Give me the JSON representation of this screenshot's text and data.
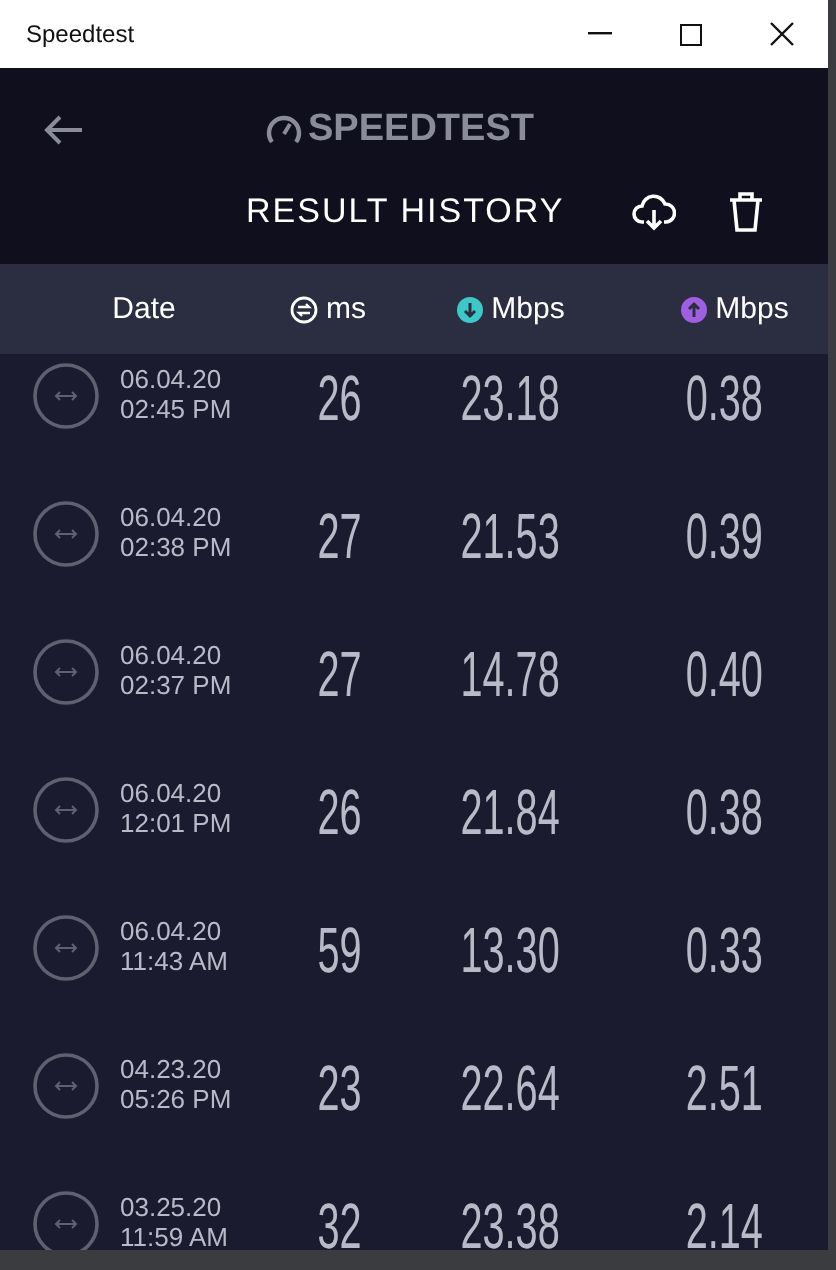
{
  "window": {
    "title": "Speedtest"
  },
  "header": {
    "logo": "SPEEDTEST",
    "title": "RESULT HISTORY"
  },
  "columns": [
    {
      "kind": "date",
      "label": "Date"
    },
    {
      "kind": "ping",
      "label": "ms"
    },
    {
      "kind": "download",
      "label": "Mbps"
    },
    {
      "kind": "upload",
      "label": "Mbps"
    }
  ],
  "rows": [
    {
      "date": "06.04.20",
      "time": "02:45 PM",
      "ping": "26",
      "download": "23.18",
      "upload": "0.38"
    },
    {
      "date": "06.04.20",
      "time": "02:38 PM",
      "ping": "27",
      "download": "21.53",
      "upload": "0.39"
    },
    {
      "date": "06.04.20",
      "time": "02:37 PM",
      "ping": "27",
      "download": "14.78",
      "upload": "0.40"
    },
    {
      "date": "06.04.20",
      "time": "12:01 PM",
      "ping": "26",
      "download": "21.84",
      "upload": "0.38"
    },
    {
      "date": "06.04.20",
      "time": "11:43 AM",
      "ping": "59",
      "download": "13.30",
      "upload": "0.33"
    },
    {
      "date": "04.23.20",
      "time": "05:26 PM",
      "ping": "23",
      "download": "22.64",
      "upload": "2.51"
    },
    {
      "date": "03.25.20",
      "time": "11:59 AM",
      "ping": "32",
      "download": "23.38",
      "upload": "2.14"
    }
  ]
}
